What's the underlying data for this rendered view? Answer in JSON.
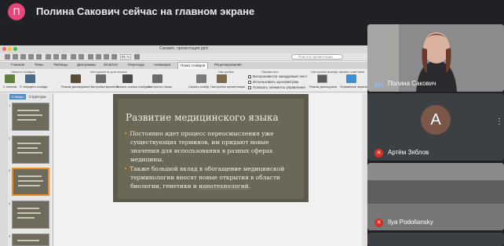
{
  "banner": {
    "avatar_letter": "П",
    "text": "Полина Сакович сейчас на главном экране",
    "avatar_color": "#e8457a"
  },
  "screen": {
    "window_title": "Сакович, презентация.pptx",
    "zoom": "95 %",
    "search_placeholder": "Поиск в презентации",
    "tabs": [
      "Главная",
      "Темы",
      "Таблицы",
      "Диаграммы",
      "SmartArt",
      "Переходы",
      "Анимация",
      "Показ слайдов",
      "Рецензирование"
    ],
    "active_tab": "Показ слайдов",
    "ribbon_groups": [
      "Начало слайдов",
      "Инструменты для показа",
      "Настройка",
      "Параметры",
      "Настройка вывода экрана советника"
    ],
    "ribbon_buttons": [
      "С начала",
      "С текущего слайда",
      "Режим докладчика",
      "Настройка времени",
      "Запись показа слайдов",
      "Настроить показ",
      "Скрыть слайд",
      "Настройка презентации",
      "Режим докладчика",
      "Отражение экрана"
    ],
    "checkboxes": [
      "Воспроизвести закадровый текст",
      "Использовать хронометраж",
      "Показать элементы управления"
    ],
    "left_tabs": [
      "Слайды",
      "Структура"
    ],
    "thumbnail_numbers": [
      "1",
      "2",
      "3",
      "4",
      "5"
    ],
    "selected_thumbnail": 3
  },
  "slide": {
    "title": "Развитие медицинского языка",
    "bullets": [
      [
        "Постоянно идет процесс переосмысления уже",
        "существующих терминов, им придают новые",
        "значения для использования в разных сферах",
        "медицины."
      ],
      [
        "Также большой вклад в обогащение медицинской",
        "терминологии вносят новые открытия в области",
        "биологии, генетики и "
      ]
    ],
    "underlined_word": "нанотехнологий",
    "after_underline": "."
  },
  "participants": [
    {
      "name": "Полина Сакович",
      "mic": "speaking"
    },
    {
      "name": "Артём Зяблов",
      "avatar_letter": "А",
      "mic": "off"
    },
    {
      "name": "Ilya Podoliansky",
      "mic": "off"
    }
  ],
  "colors": {
    "meet_bg": "#202124",
    "accent_orange": "#f08c1e",
    "mic_off_red": "#d93025"
  }
}
